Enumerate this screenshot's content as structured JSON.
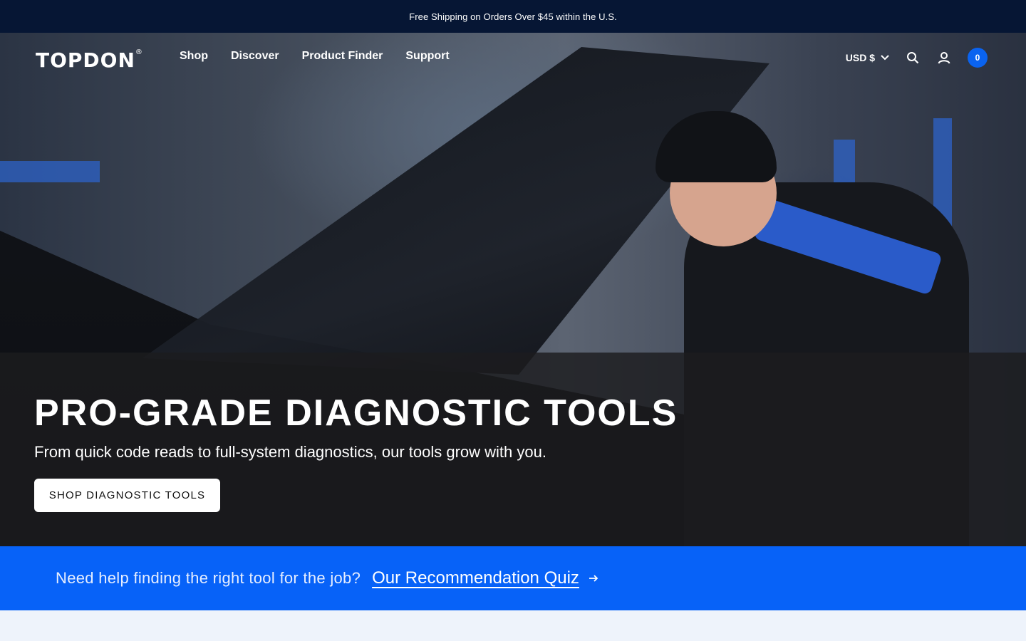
{
  "announcement": {
    "text": "Free Shipping on Orders Over $45 within the U.S."
  },
  "nav": {
    "logo": "TOPDON",
    "logo_mark": "®",
    "items": [
      {
        "label": "Shop"
      },
      {
        "label": "Discover"
      },
      {
        "label": "Product Finder"
      },
      {
        "label": "Support"
      }
    ],
    "currency": "USD $",
    "cart_count": "0"
  },
  "hero": {
    "title": "PRO-GRADE DIAGNOSTIC TOOLS",
    "subtitle": "From quick code reads to full-system diagnostics, our tools grow with you.",
    "cta_label": "SHOP DIAGNOSTIC TOOLS"
  },
  "quiz": {
    "text": "Need help finding the right tool for the job?",
    "link_label": "Our Recommendation Quiz"
  },
  "colors": {
    "announcement_bg": "#061634",
    "brand_blue": "#0762f8",
    "cart_badge": "#0a63f0"
  }
}
